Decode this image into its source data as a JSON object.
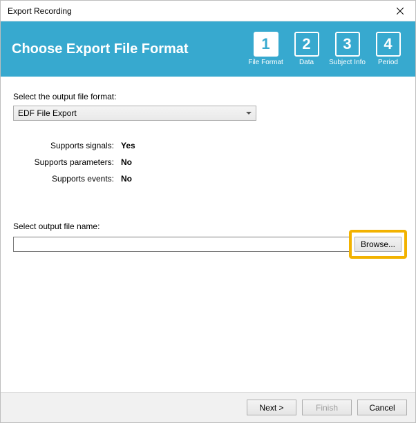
{
  "window": {
    "title": "Export Recording"
  },
  "header": {
    "title": "Choose Export File Format"
  },
  "steps": [
    {
      "num": "1",
      "label": "File Format",
      "active": true
    },
    {
      "num": "2",
      "label": "Data",
      "active": false
    },
    {
      "num": "3",
      "label": "Subject Info",
      "active": false
    },
    {
      "num": "4",
      "label": "Period",
      "active": false
    }
  ],
  "format": {
    "prompt": "Select the output file format:",
    "selected": "EDF File Export"
  },
  "props": {
    "signals_label": "Supports signals:",
    "signals_value": "Yes",
    "params_label": "Supports parameters:",
    "params_value": "No",
    "events_label": "Supports events:",
    "events_value": "No"
  },
  "output": {
    "prompt": "Select output file name:",
    "value": "",
    "browse": "Browse..."
  },
  "footer": {
    "next": "Next >",
    "finish": "Finish",
    "cancel": "Cancel"
  }
}
